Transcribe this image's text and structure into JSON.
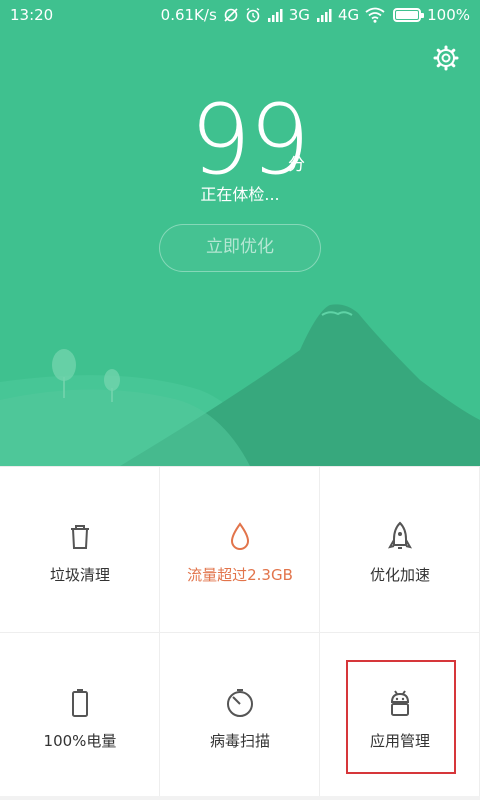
{
  "status_bar": {
    "time": "13:20",
    "net_speed": "0.61K/s",
    "sim1": "3G",
    "sim2": "4G",
    "battery": "100%"
  },
  "header": {
    "score": "99",
    "score_unit": "分",
    "status_text": "正在体检...",
    "optimize_button": "立即优化",
    "settings_icon": "gear-icon"
  },
  "tiles": [
    {
      "label": "垃圾清理",
      "icon": "trash-icon"
    },
    {
      "label": "流量超过2.3GB",
      "icon": "drop-icon"
    },
    {
      "label": "优化加速",
      "icon": "rocket-icon"
    },
    {
      "label": "100%电量",
      "icon": "battery-icon"
    },
    {
      "label": "病毒扫描",
      "icon": "scan-icon"
    },
    {
      "label": "应用管理",
      "icon": "android-icon"
    }
  ],
  "colors": {
    "hero": "#3fc18f",
    "warning_text": "#e2744b",
    "highlight": "#d6363a"
  }
}
